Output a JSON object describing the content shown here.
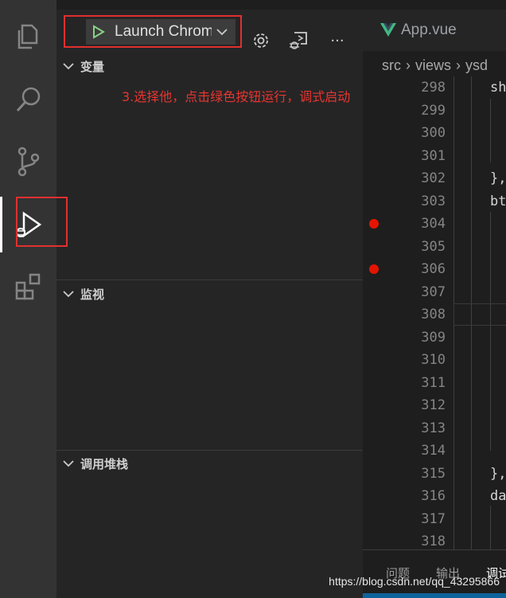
{
  "debug_toolbar": {
    "config_label": "Launch Chrome",
    "settings_icon": "gear-icon",
    "console_icon": "debug-console-icon",
    "more_icon": "ellipsis-icon",
    "more_label": "···"
  },
  "sections": {
    "variables": "变量",
    "watch": "监视",
    "call_stack": "调用堆栈"
  },
  "annotation": "3.选择他，点击绿色按钮运行，调式启动",
  "activity_bar": [
    "files-icon",
    "search-icon",
    "source-control-icon",
    "run-debug-icon",
    "extensions-icon"
  ],
  "editor": {
    "tab_label": "App.vue",
    "breadcrumb": [
      "src",
      "views",
      "ysd"
    ],
    "lines": [
      {
        "n": "298",
        "code": "sh"
      },
      {
        "n": "299",
        "code": ""
      },
      {
        "n": "300",
        "code": ""
      },
      {
        "n": "301",
        "code": ""
      },
      {
        "n": "302",
        "code": "},"
      },
      {
        "n": "303",
        "code": "bt"
      },
      {
        "n": "304",
        "code": "",
        "breakpoint": true
      },
      {
        "n": "305",
        "code": ""
      },
      {
        "n": "306",
        "code": "",
        "breakpoint": true
      },
      {
        "n": "307",
        "code": ""
      },
      {
        "n": "308",
        "code": ""
      },
      {
        "n": "309",
        "code": ""
      },
      {
        "n": "310",
        "code": ""
      },
      {
        "n": "311",
        "code": ""
      },
      {
        "n": "312",
        "code": ""
      },
      {
        "n": "313",
        "code": ""
      },
      {
        "n": "314",
        "code": ""
      },
      {
        "n": "315",
        "code": "},"
      },
      {
        "n": "316",
        "code": "da"
      },
      {
        "n": "317",
        "code": ""
      },
      {
        "n": "318",
        "code": ""
      }
    ]
  },
  "panel": {
    "tabs": [
      "问题",
      "输出",
      "调试"
    ]
  },
  "watermark": "https://blog.csdn.net/qq_43295866",
  "colors": {
    "accent_green": "#89d185",
    "vue_green": "#41b883",
    "annotation_red": "#e8352f",
    "breakpoint_red": "#e51400"
  }
}
